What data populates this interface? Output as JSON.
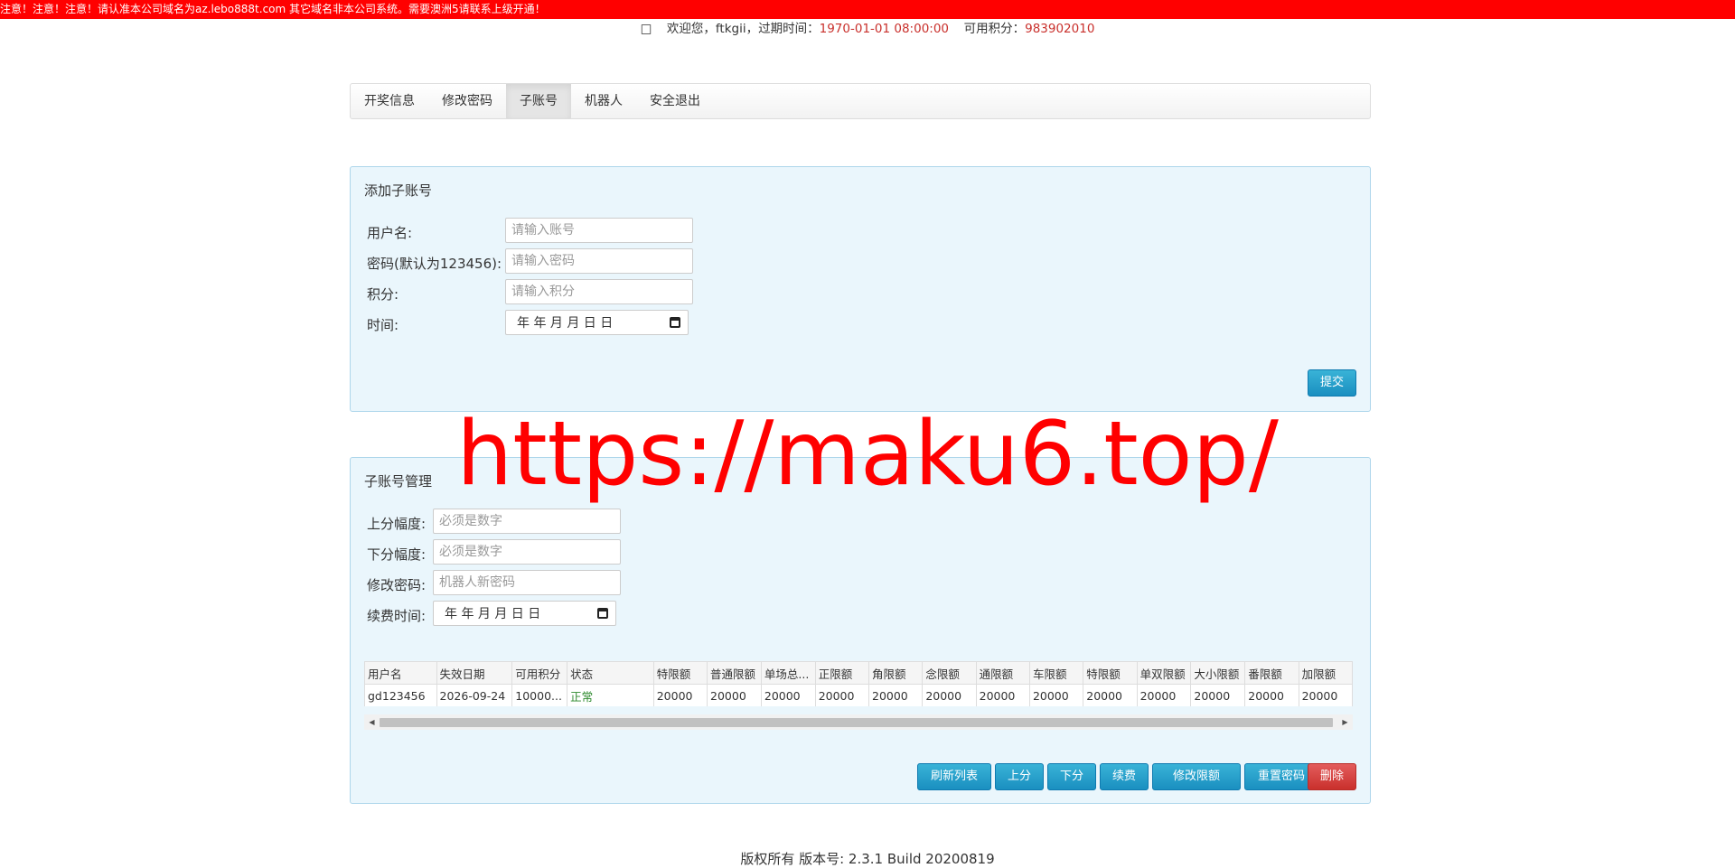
{
  "notice": {
    "text": "注意！注意！注意！请认准本公司域名为az.lebo888t.com 其它域名非本公司系统。需要澳洲5请联系上级开通！"
  },
  "header": {
    "icon": "user-icon",
    "welcome": "欢迎您，ftkgii，过期时间：",
    "expire": "1970-01-01 08:00:00",
    "points_label": "可用积分：",
    "points": "983902010"
  },
  "nav": {
    "items": [
      "开奖信息",
      "修改密码",
      "子账号",
      "机器人",
      "安全退出"
    ],
    "active": "子账号"
  },
  "add_panel": {
    "title": "添加子账号",
    "username_label": "用户名:",
    "username_placeholder": "请输入账号",
    "password_label": "密码(默认为123456):",
    "password_placeholder": "请输入密码",
    "points_label": "积分:",
    "points_placeholder": "请输入积分",
    "time_label": "时间:",
    "time_value": "年 年 月 月 日 日",
    "submit": "提交"
  },
  "manage_panel": {
    "title": "子账号管理",
    "up_label": "上分幅度:",
    "up_placeholder": "必须是数字",
    "down_label": "下分幅度:",
    "down_placeholder": "必须是数字",
    "pwd_label": "修改密码:",
    "pwd_placeholder": "机器人新密码",
    "renew_label": "续费时间:",
    "renew_value": "年 年 月 月 日 日",
    "table": {
      "headers": [
        "用户名",
        "失效日期",
        "可用积分",
        "状态",
        "特限额",
        "普通限额",
        "单场总...",
        "正限额",
        "角限额",
        "念限额",
        "通限额",
        "车限额",
        "特限额",
        "单双限额",
        "大小限额",
        "番限额",
        "加限额"
      ],
      "rows": [
        [
          "gd123456",
          "2026-09-24",
          "10000...",
          "正常",
          "20000",
          "20000",
          "20000",
          "20000",
          "20000",
          "20000",
          "20000",
          "20000",
          "20000",
          "20000",
          "20000",
          "20000",
          "20000"
        ]
      ]
    },
    "buttons": {
      "refresh": "刷新列表",
      "up": "上分",
      "down": "下分",
      "renew": "续费",
      "limit": "修改限额",
      "reset_pwd": "重置密码",
      "delete": "删除"
    }
  },
  "watermark": "https://maku6.top/",
  "footer": "版权所有 版本号: 2.3.1 Build 20200819"
}
